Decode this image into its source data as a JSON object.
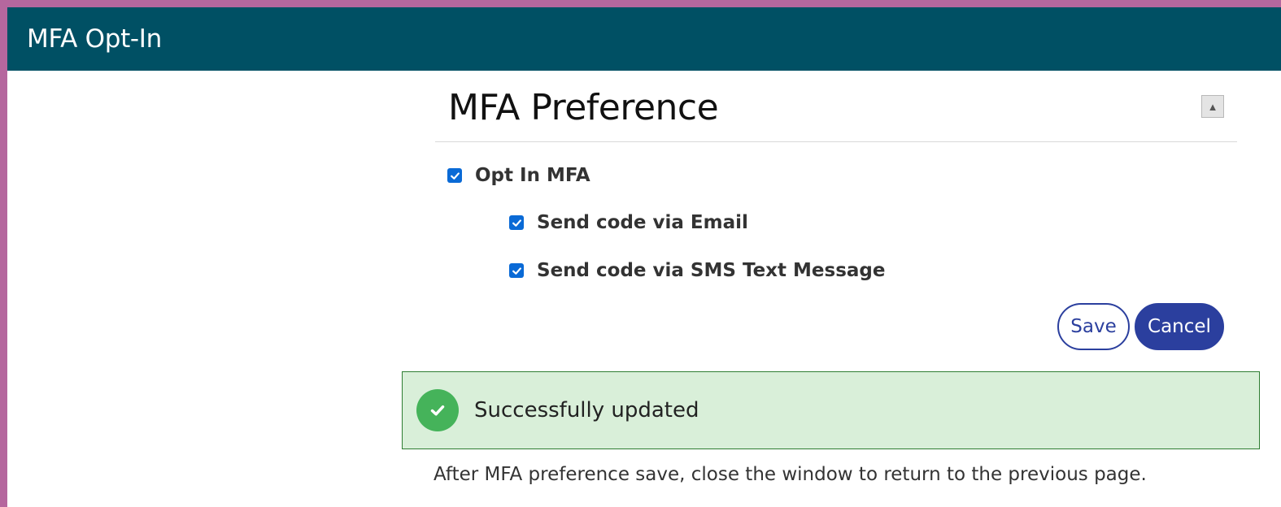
{
  "window": {
    "title": "MFA Opt-In"
  },
  "panel": {
    "title": "MFA Preference",
    "collapse_glyph": "▲"
  },
  "options": {
    "opt_in": {
      "label": "Opt In MFA",
      "checked": true
    },
    "email": {
      "label": "Send code via Email",
      "checked": true
    },
    "sms": {
      "label": "Send code via SMS Text Message",
      "checked": true
    }
  },
  "actions": {
    "save_label": "Save",
    "cancel_label": "Cancel"
  },
  "status": {
    "message": "Successfully updated"
  },
  "footnote": "After MFA preference save, close the window to return to the previous page.",
  "colors": {
    "titlebar": "#005064",
    "page_border": "#b5679e",
    "primary": "#2b3f9e",
    "checkbox": "#0a6ad6",
    "success_bg": "#d9efd9",
    "success_border": "#2e7d32",
    "success_icon": "#45b35a"
  },
  "icons": {
    "collapse": "triangle-up-icon",
    "success": "check-circle-icon",
    "checkbox": "checkmark-icon"
  }
}
